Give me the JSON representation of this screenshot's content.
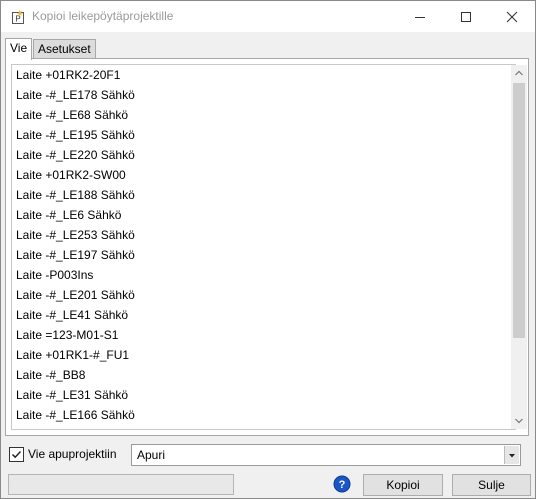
{
  "window": {
    "title": "Kopioi leikepöytäprojektille",
    "icon": "app-p-icon"
  },
  "tabs": [
    {
      "label": "Vie",
      "active": true
    },
    {
      "label": "Asetukset",
      "active": false
    }
  ],
  "list": {
    "items": [
      "Laite +01RK2-20F1",
      "Laite -#_LE178 Sähkö",
      "Laite -#_LE68 Sähkö",
      "Laite -#_LE195 Sähkö",
      "Laite -#_LE220 Sähkö",
      "Laite +01RK2-SW00",
      "Laite -#_LE188 Sähkö",
      "Laite -#_LE6 Sähkö",
      "Laite -#_LE253 Sähkö",
      "Laite -#_LE197 Sähkö",
      "Laite -P003Ins",
      "Laite -#_LE201 Sähkö",
      "Laite -#_LE41 Sähkö",
      "Laite =123-M01-S1",
      "Laite +01RK1-#_FU1",
      "Laite -#_BB8",
      "Laite -#_LE31 Sähkö",
      "Laite -#_LE166 Sähkö"
    ]
  },
  "export": {
    "checkbox_label": "Vie apuprojektiin",
    "checked": true,
    "target_project": "Apuri"
  },
  "buttons": {
    "copy": "Kopioi",
    "close": "Sulje"
  },
  "colors": {
    "help_blue": "#1a56c8",
    "scroll_thumb": "#cdcdcd"
  }
}
